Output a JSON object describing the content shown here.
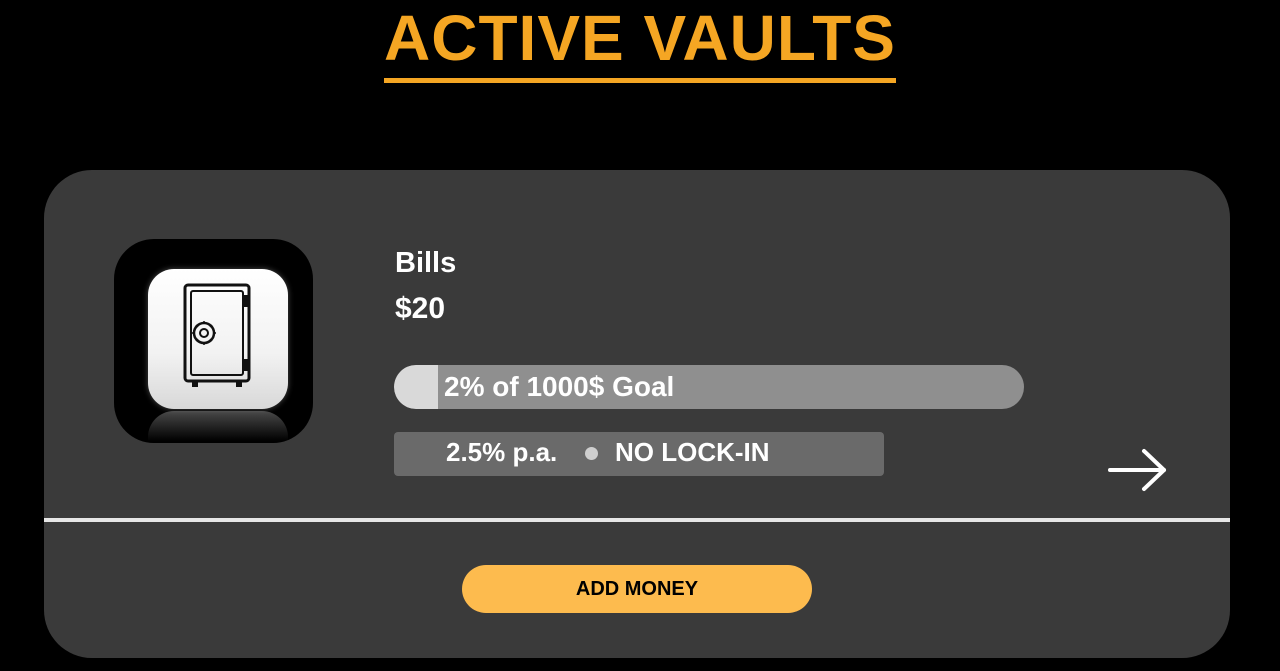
{
  "header": {
    "title": "ACTIVE VAULTS"
  },
  "vault": {
    "icon": "safe-icon",
    "name": "Bills",
    "amount": "$20",
    "progress_text": "2% of 1000$ Goal",
    "progress_fraction": 0.07,
    "rate": "2.5% p.a.",
    "lock_in": "NO LOCK-IN",
    "open_icon": "arrow-right-icon",
    "add_money_label": "ADD MONEY"
  },
  "colors": {
    "accent": "#F5A623",
    "button": "#FDBB4E",
    "card": "#3A3A3A",
    "background": "#000000"
  }
}
